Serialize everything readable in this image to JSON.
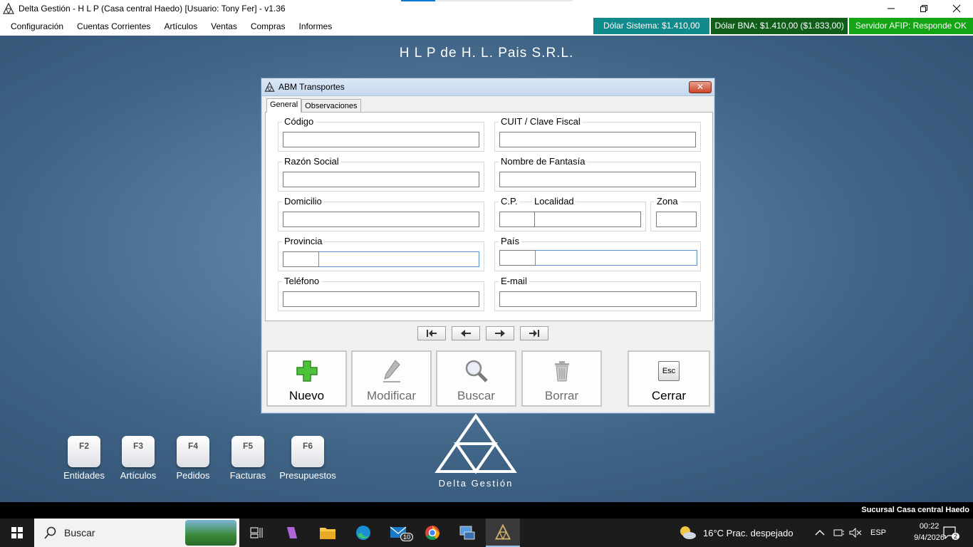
{
  "window": {
    "title": "Delta Gestión - H L P (Casa central Haedo) [Usuario: Tony Fer] - v1.36"
  },
  "menu": {
    "items": [
      "Configuración",
      "Cuentas Corrientes",
      "Artículos",
      "Ventas",
      "Compras",
      "Informes"
    ]
  },
  "status": {
    "dolar_sistema": "Dólar Sistema: $1.410,00",
    "dolar_bna": "Dólar BNA: $1.410,00 ($1.833,00)",
    "servidor_afip": "Servidor AFIP:  Responde OK"
  },
  "company_title": "H L P de H. L. Pais S.R.L.",
  "dialog": {
    "title": "ABM Transportes",
    "close_label": "✕",
    "tabs": [
      "General",
      "Observaciones"
    ],
    "fields": {
      "codigo": "Código",
      "cuit": "CUIT / Clave Fiscal",
      "razon_social": "Razón Social",
      "nombre_fantasia": "Nombre de Fantasía",
      "domicilio": "Domicilio",
      "cp": "C.P.",
      "localidad": "Localidad",
      "zona": "Zona",
      "provincia": "Provincia",
      "pais": "País",
      "telefono": "Teléfono",
      "email": "E-mail"
    },
    "buttons": {
      "nuevo": "Nuevo",
      "modificar": "Modificar",
      "buscar": "Buscar",
      "borrar": "Borrar",
      "cerrar": "Cerrar",
      "esc": "Esc"
    }
  },
  "shortcuts": [
    {
      "key": "F2",
      "label": "Entidades"
    },
    {
      "key": "F3",
      "label": "Artículos"
    },
    {
      "key": "F4",
      "label": "Pedidos"
    },
    {
      "key": "F5",
      "label": "Facturas"
    },
    {
      "key": "F6",
      "label": "Presupuestos"
    }
  ],
  "brand": "Delta Gestión",
  "branch": "Sucursal Casa central Haedo",
  "taskbar": {
    "search_placeholder": "Buscar",
    "mail_badge": "10",
    "weather": "16°C  Prac. despejado",
    "lang": "ESP",
    "time": "00:22",
    "date": "9/4/2026",
    "notif_count": "2"
  },
  "colors": {
    "dolar_sistema_bg": "#108a8a",
    "dolar_bna_bg": "#0f5f1a",
    "afip_bg": "#14a514"
  }
}
